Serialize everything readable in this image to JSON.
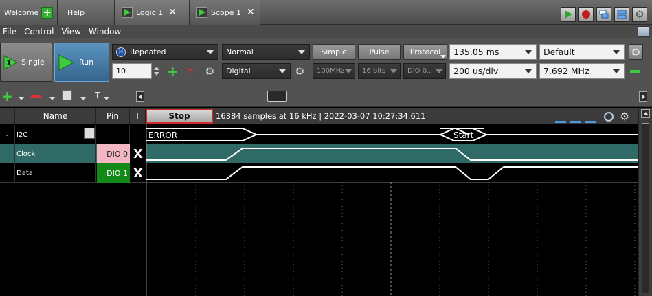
{
  "tabs": [
    {
      "label": "Welcome",
      "icon": "plus-icon"
    },
    {
      "label": "Help",
      "icon": ""
    },
    {
      "label": "Logic 1",
      "icon": "logic-icon",
      "closable": true
    },
    {
      "label": "Scope 1",
      "icon": "scope-icon",
      "closable": true
    }
  ],
  "menu": [
    "File",
    "Control",
    "View",
    "Window"
  ],
  "toolbar": {
    "single_label": "Single",
    "run_label": "Run",
    "mode_value": "Repeated",
    "count_value": "10",
    "trigger_mode": "Normal",
    "channel_type": "Digital",
    "trigger_types": [
      "Simple",
      "Pulse",
      "Protocol"
    ],
    "rate_value": "100MHz",
    "bits_value": "16 bits",
    "dio_value": "DIO 0..",
    "time_value": "135.05 ms",
    "div_value": "200 us/div",
    "preset_value": "Default",
    "freq_value": "7.692 MHz"
  },
  "waveform": {
    "headers": {
      "name": "Name",
      "pin": "Pin",
      "t": "T"
    },
    "stop_label": "Stop",
    "status": "16384 samples at 16 kHz | 2022-03-07 10:27:34.611",
    "rows": [
      {
        "expand": "-",
        "name": "I2C",
        "pin": "",
        "t": ""
      },
      {
        "expand": "",
        "name": "Clock",
        "pin": "DIO 0",
        "t": "X"
      },
      {
        "expand": "",
        "name": "Data",
        "pin": "DIO 1",
        "t": "X"
      }
    ],
    "bus_labels": [
      "ERROR",
      "Start"
    ]
  },
  "colors": {
    "accent_green": "#35b235",
    "stop_border": "#d32b2b",
    "clock_row_bg": "#2f6a66",
    "pin_clock_bg": "#f3b8c4",
    "pin_data_bg": "#138a18"
  }
}
